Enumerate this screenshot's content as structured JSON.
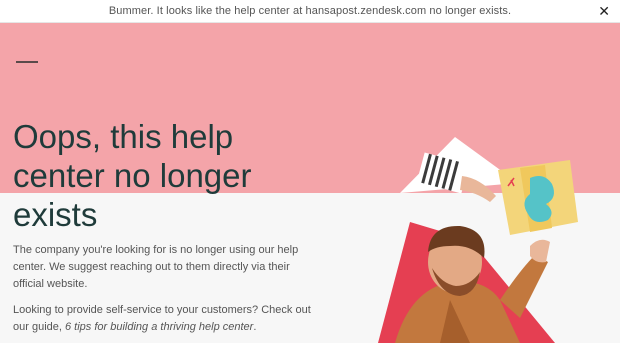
{
  "banner": {
    "message": "Bummer. It looks like the help center at hansapost.zendesk.com no longer exists.",
    "close_icon": "close-icon",
    "close_glyph": "✕"
  },
  "colors": {
    "hero_bg": "#f4a4a9",
    "page_bg": "#f7f7f7",
    "headline": "#1f3b3a",
    "accent_red": "#e53f52"
  },
  "main": {
    "headline_line1": "Oops, this help",
    "headline_line2": "center no longer",
    "headline_line3": "exists",
    "paragraph1": "The company you're looking for is no longer using our help center. We suggest reaching out to them directly via their official website.",
    "paragraph2_prefix": "Looking to provide self-service to your customers? Check out our guide,",
    "paragraph2_link": "6 tips for building a thriving help center",
    "paragraph2_suffix": "."
  }
}
